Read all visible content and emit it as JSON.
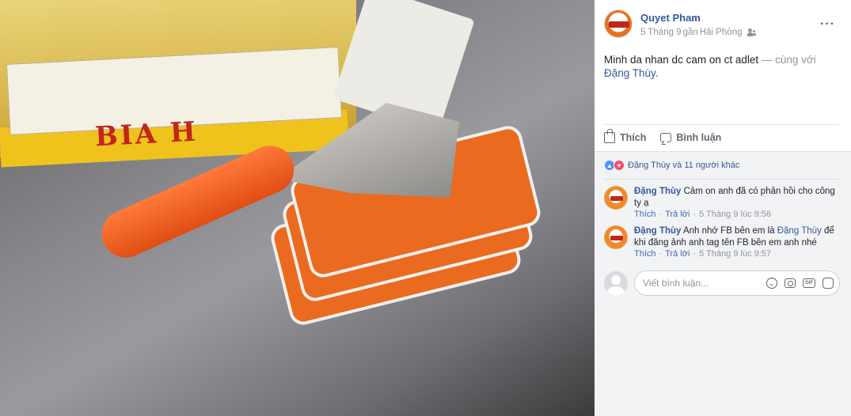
{
  "photo": {
    "box_print": "BIA H"
  },
  "post": {
    "author": "Quyet Pham",
    "date": "5 Tháng 9",
    "location_prefix": "gần",
    "location": "Hải Phòng",
    "more_label": "···",
    "text": "Minh da nhan dc cam on ct adlet",
    "with_label": "— cùng với",
    "tagged": "Đặng Thùy."
  },
  "actions": {
    "like": "Thích",
    "comment": "Bình luận"
  },
  "reactions": {
    "summary": "Đặng Thùy và 11 người khác"
  },
  "comments": [
    {
      "author": "Đặng Thùy",
      "text": "Cảm on anh đã có phản hồi cho công ty ạ",
      "like": "Thích",
      "reply": "Trả lời",
      "time": "5 Tháng 9 lúc 9:56"
    },
    {
      "author": "Đặng Thùy",
      "text_before": "Anh nhớ FB bên em là",
      "tag": "Đặng Thùy",
      "text_after": "để khi đăng ảnh anh tag tên FB bên em anh nhé",
      "like": "Thích",
      "reply": "Trả lời",
      "time": "5 Tháng 9 lúc 9:57"
    }
  ],
  "composer": {
    "placeholder": "Viết bình luận...",
    "gif_label": "GIF"
  },
  "icons": {
    "emoji": "emoji-icon",
    "camera": "camera-icon",
    "gif": "gif-icon",
    "sticker": "sticker-icon"
  },
  "colors": {
    "link": "#365899",
    "meta": "#90949c",
    "like_reaction": "#5890ff",
    "love_reaction": "#f25268"
  }
}
